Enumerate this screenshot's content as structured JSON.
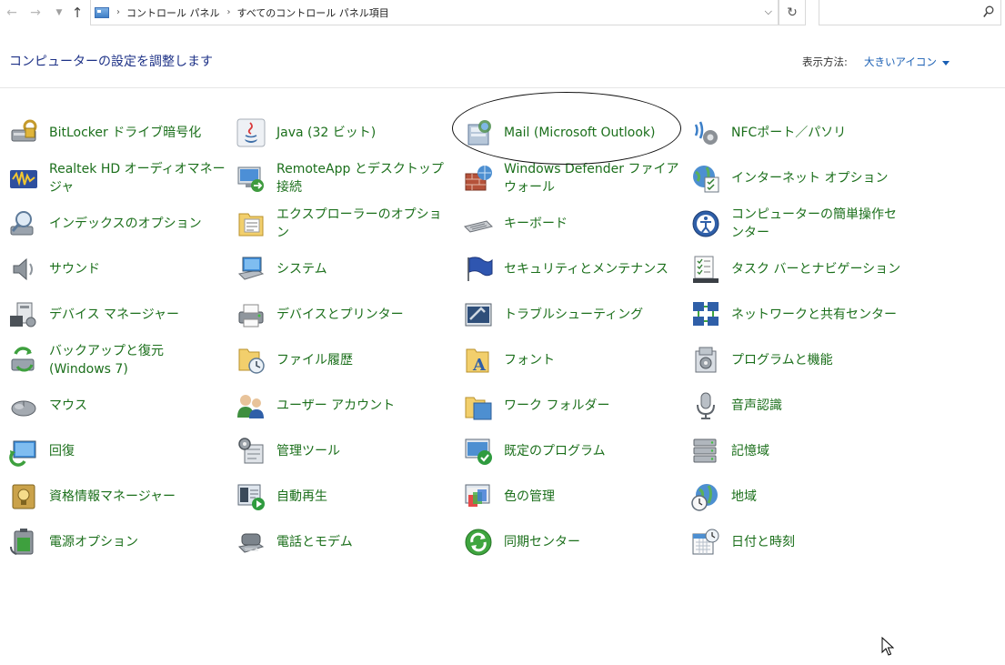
{
  "address_bar": {
    "breadcrumbs": [
      "コントロール パネル",
      "すべてのコントロール パネル項目"
    ],
    "search_placeholder": ""
  },
  "header": {
    "title": "コンピューターの設定を調整します",
    "view_label": "表示方法:",
    "view_value": "大きいアイコン"
  },
  "items": [
    {
      "label": "BitLocker ドライブ暗号化",
      "icon": "bitlocker-icon"
    },
    {
      "label": "Java (32 ビット)",
      "icon": "java-icon"
    },
    {
      "label": "Mail (Microsoft Outlook)",
      "icon": "mail-icon"
    },
    {
      "label": "NFCポート／パソリ",
      "icon": "nfc-icon"
    },
    {
      "label": "Realtek HD オーディオマネージャ",
      "icon": "realtek-audio-icon"
    },
    {
      "label": "RemoteApp とデスクトップ接続",
      "icon": "remoteapp-icon"
    },
    {
      "label": "Windows Defender ファイアウォール",
      "icon": "firewall-icon"
    },
    {
      "label": "インターネット オプション",
      "icon": "internet-options-icon"
    },
    {
      "label": "インデックスのオプション",
      "icon": "indexing-icon"
    },
    {
      "label": "エクスプローラーのオプション",
      "icon": "explorer-options-icon"
    },
    {
      "label": "キーボード",
      "icon": "keyboard-icon"
    },
    {
      "label": "コンピューターの簡単操作センター",
      "icon": "ease-of-access-icon"
    },
    {
      "label": "サウンド",
      "icon": "sound-icon"
    },
    {
      "label": "システム",
      "icon": "system-icon"
    },
    {
      "label": "セキュリティとメンテナンス",
      "icon": "security-maintenance-icon"
    },
    {
      "label": "タスク バーとナビゲーション",
      "icon": "taskbar-icon"
    },
    {
      "label": "デバイス マネージャー",
      "icon": "device-manager-icon"
    },
    {
      "label": "デバイスとプリンター",
      "icon": "printer-icon"
    },
    {
      "label": "トラブルシューティング",
      "icon": "troubleshooting-icon"
    },
    {
      "label": "ネットワークと共有センター",
      "icon": "network-icon"
    },
    {
      "label": "バックアップと復元 (Windows 7)",
      "icon": "backup-icon"
    },
    {
      "label": "ファイル履歴",
      "icon": "file-history-icon"
    },
    {
      "label": "フォント",
      "icon": "fonts-icon"
    },
    {
      "label": "プログラムと機能",
      "icon": "programs-icon"
    },
    {
      "label": "マウス",
      "icon": "mouse-icon"
    },
    {
      "label": "ユーザー アカウント",
      "icon": "user-accounts-icon"
    },
    {
      "label": "ワーク フォルダー",
      "icon": "work-folders-icon"
    },
    {
      "label": "音声認識",
      "icon": "microphone-icon"
    },
    {
      "label": "回復",
      "icon": "recovery-icon"
    },
    {
      "label": "管理ツール",
      "icon": "admin-tools-icon"
    },
    {
      "label": "既定のプログラム",
      "icon": "default-programs-icon"
    },
    {
      "label": "記憶域",
      "icon": "storage-icon"
    },
    {
      "label": "資格情報マネージャー",
      "icon": "credential-icon"
    },
    {
      "label": "自動再生",
      "icon": "autoplay-icon"
    },
    {
      "label": "色の管理",
      "icon": "color-management-icon"
    },
    {
      "label": "地域",
      "icon": "region-icon"
    },
    {
      "label": "電源オプション",
      "icon": "power-icon"
    },
    {
      "label": "電話とモデム",
      "icon": "phone-modem-icon"
    },
    {
      "label": "同期センター",
      "icon": "sync-center-icon"
    },
    {
      "label": "日付と時刻",
      "icon": "date-time-icon"
    }
  ],
  "colors": {
    "item_text": "#1b6f1b",
    "title_text": "#1e3287",
    "link_text": "#1a5fb4"
  }
}
